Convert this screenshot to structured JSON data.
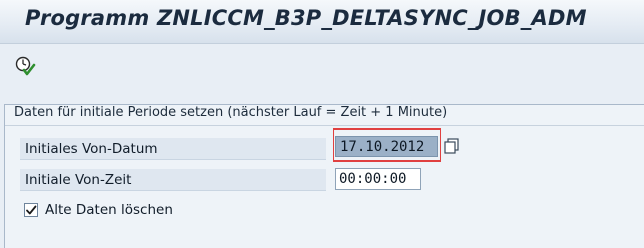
{
  "window": {
    "title": "Programm ZNLICCM_B3P_DELTASYNC_JOB_ADM"
  },
  "toolbar": {
    "execute_icon": "execute-clock-check-icon"
  },
  "group": {
    "title": "Daten für initiale Periode setzen (nächster Lauf = Zeit + 1 Minute)"
  },
  "fields": {
    "date_label": "Initiales Von-Datum",
    "date_value": "17.10.2012",
    "time_label": "Initiale Von-Zeit",
    "time_value": "00:00:00",
    "checkbox_label": "Alte Daten löschen",
    "checkbox_checked": true
  },
  "colors": {
    "background": "#e8eef5",
    "focus_border": "#e04040",
    "selected_field": "#9bb0c7"
  }
}
